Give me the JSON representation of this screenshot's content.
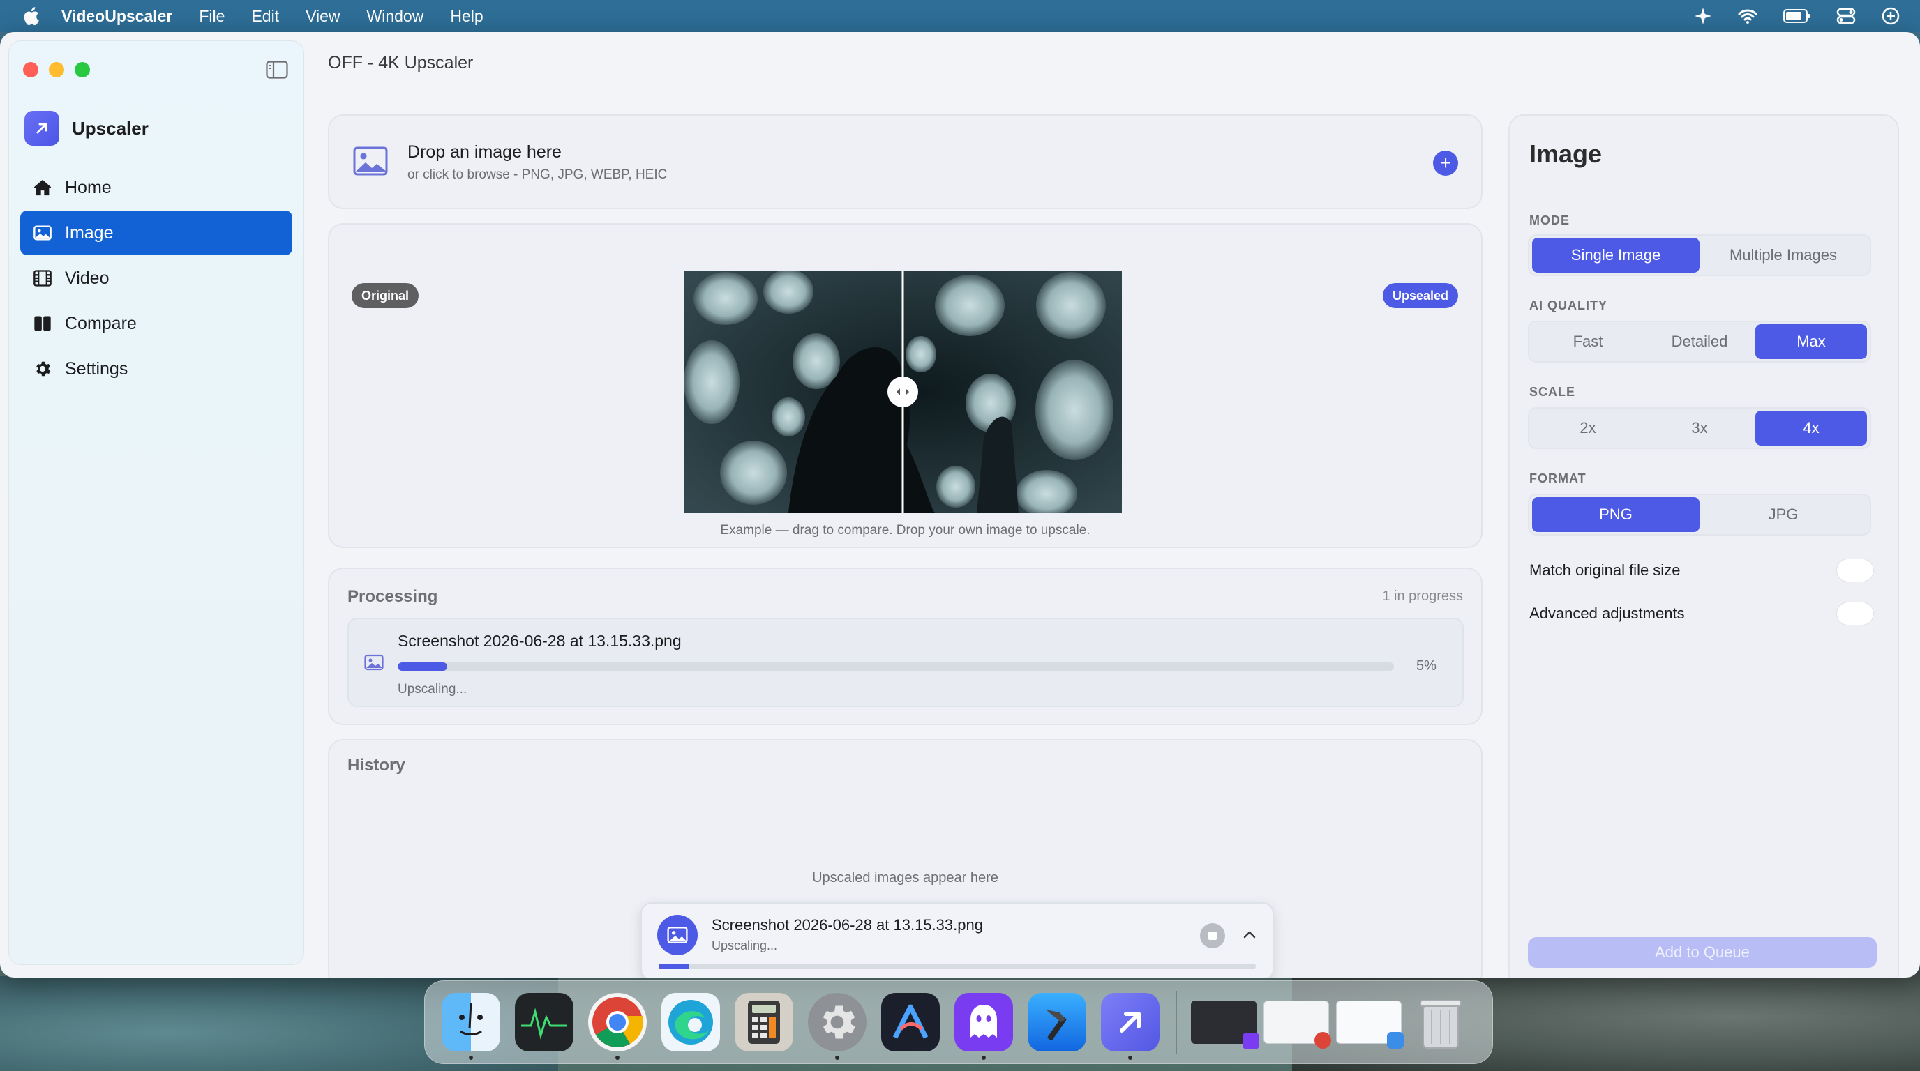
{
  "menubar": {
    "app_name": "VideoUpscaler",
    "items": [
      "File",
      "Edit",
      "View",
      "Window",
      "Help"
    ]
  },
  "window": {
    "title": "OFF - 4K Upscaler"
  },
  "sidebar": {
    "brand": "Upscaler",
    "items": [
      {
        "label": "Home",
        "icon": "house-icon"
      },
      {
        "label": "Image",
        "icon": "image-icon",
        "active": true
      },
      {
        "label": "Video",
        "icon": "film-icon"
      },
      {
        "label": "Compare",
        "icon": "compare-icon"
      },
      {
        "label": "Settings",
        "icon": "gear-icon"
      }
    ]
  },
  "drop": {
    "title": "Drop an image here",
    "subtitle": "or click to browse - PNG, JPG, WEBP, HEIC"
  },
  "compare": {
    "badge_original": "Original",
    "badge_upscaled": "Upsealed",
    "caption": "Example — drag to compare. Drop your own image to upscale."
  },
  "processing": {
    "heading": "Processing",
    "count": "1 in progress",
    "job": {
      "filename": "Screenshot 2026-06-28 at 13.15.33.png",
      "progress_percent": 5,
      "progress_label": "5%",
      "status": "Upscaling..."
    }
  },
  "history": {
    "heading": "History",
    "empty": "Upscaled images appear here"
  },
  "mini_progress": {
    "filename": "Screenshot 2026-06-28 at 13.15.33.png",
    "status": "Upscaling...",
    "progress_percent": 5
  },
  "settings": {
    "title": "Image",
    "mode": {
      "label": "MODE",
      "options": [
        "Single Image",
        "Multiple Images"
      ],
      "selected": "Single Image"
    },
    "quality": {
      "label": "AI QUALITY",
      "options": [
        "Fast",
        "Detailed",
        "Max"
      ],
      "selected": "Max"
    },
    "scale": {
      "label": "SCALE",
      "options": [
        "2x",
        "3x",
        "4x"
      ],
      "selected": "4x"
    },
    "format": {
      "label": "FORMAT",
      "options": [
        "PNG",
        "JPG"
      ],
      "selected": "PNG"
    },
    "toggles": [
      {
        "label": "Match original file size",
        "on": false
      },
      {
        "label": "Advanced adjustments",
        "on": false
      }
    ],
    "queue_button": "Add to Queue"
  },
  "colors": {
    "accent": "#4d5ae6",
    "sidebar_active": "#1262d6",
    "menubar": "#2e6e97"
  },
  "dock": {
    "apps": [
      "finder-icon",
      "activity-monitor-icon",
      "chrome-icon",
      "edge-icon",
      "calculator-icon",
      "system-settings-icon",
      "arc-icon",
      "ghost-app-icon",
      "xcode-icon",
      "upscaler-app-icon"
    ],
    "windows": [
      "window-thumbnail-1",
      "window-thumbnail-2",
      "window-thumbnail-3"
    ],
    "trash": "trash-icon"
  }
}
